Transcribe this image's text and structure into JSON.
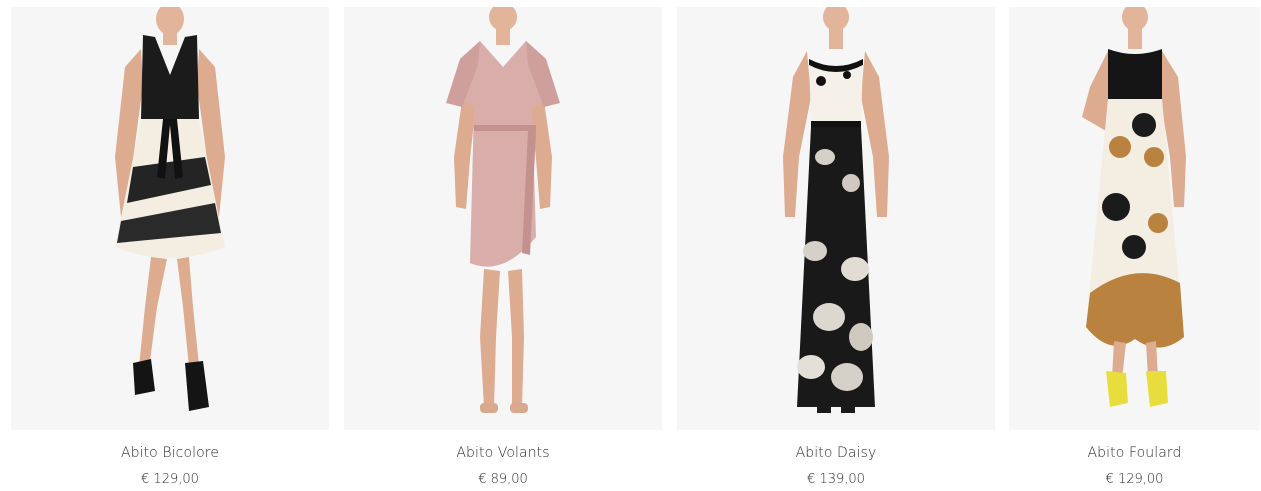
{
  "products": [
    {
      "name": "Abito Bicolore",
      "price": "€ 129,00"
    },
    {
      "name": "Abito Volants",
      "price": "€ 89,00"
    },
    {
      "name": "Abito Daisy",
      "price": "€ 139,00"
    },
    {
      "name": "Abito Foulard",
      "price": "€ 129,00"
    }
  ],
  "colors": {
    "photo_background": "#f6f6f6",
    "text": "#2d2d2d",
    "skin": "#e2b49a",
    "dress_black": "#1b1b1b",
    "dress_cream": "#f4ede2",
    "dress_pink": "#d9aeaa",
    "print_ochre": "#b9823f",
    "shoes_yellow": "#e7de3e"
  }
}
